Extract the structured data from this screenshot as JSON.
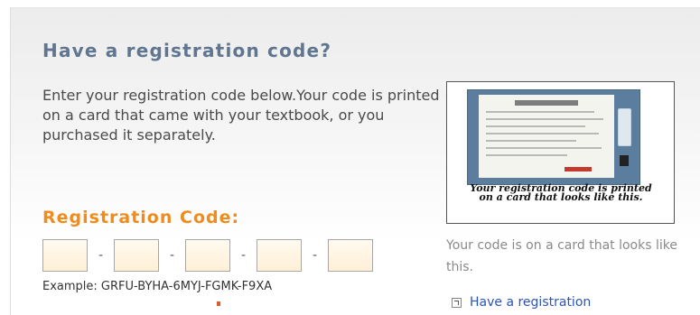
{
  "heading": "Have a registration code?",
  "intro_text": "Enter your registration code below.Your code is printed on a card that came with your textbook, or you purchased it separately.",
  "registration": {
    "label": "Registration Code:",
    "fields": [
      {
        "value": ""
      },
      {
        "value": ""
      },
      {
        "value": ""
      },
      {
        "value": ""
      },
      {
        "value": ""
      }
    ],
    "separator": "-",
    "example": "Example: GRFU-BYHA-6MYJ-FGMK-F9XA"
  },
  "card_panel": {
    "image_caption": "Your registration code is printed on a card that looks like this.",
    "note": "Your code is on a card that looks like this."
  },
  "help_link": {
    "icon": "external-link-icon",
    "label": "Have a registration"
  },
  "colors": {
    "heading": "#5f7590",
    "label": "#f08c1c",
    "link": "#2a55b8",
    "field_bg": "#fff0d6"
  }
}
